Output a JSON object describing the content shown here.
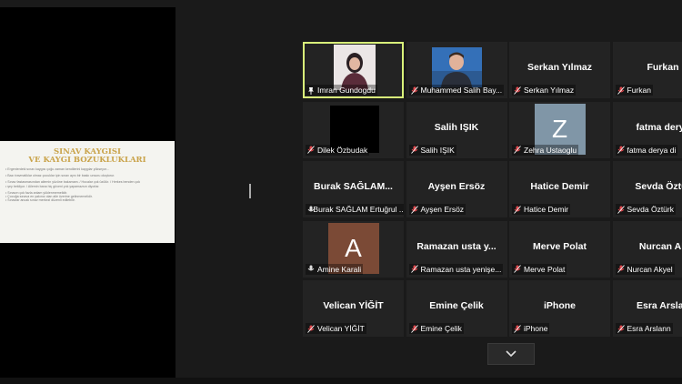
{
  "shared_screen": {
    "title_line1": "SINAV KAYGISI",
    "title_line2": "VE KAYGI BOZUKLUKLARI",
    "lines": [
      "Ergenlerdeki sınav kaygısı çoğu zaman kendilerini kaygılar yükseyor...",
      "",
      "Bazı travmatiklar olmaz çocuklar için sınav aynı bir baskı unsuru oluşturur.",
      "",
      "Sınav fastasmasından ailemin yüzüne bakamam. / Hocalar çok üzülür. / Herkes benden çok",
      "şey bekliyor. / Ailemin bana hiç güveni yok yapamazsın diyorlar.",
      "",
      "Sınavın çok fazla anlam yüklenmemelidir.",
      "Çocuğa sınava en yakınız olan aile üzerine gelinmemelidir.",
      "Sınavlar ancak sınav merkezi düzenli edilebilir."
    ]
  },
  "participants": [
    {
      "display": "",
      "label": "Imran Gundogdu",
      "muted": false,
      "video": "woman",
      "active": true
    },
    {
      "display": "",
      "label": "Muhammed Salih Bay...",
      "muted": true,
      "video": "man"
    },
    {
      "display": "Serkan Yılmaz",
      "label": "Serkan Yılmaz",
      "muted": true
    },
    {
      "display": "Furkan",
      "label": "Furkan",
      "muted": true
    },
    {
      "display": "",
      "label": "Dilek Özbudak",
      "muted": true,
      "video": "black"
    },
    {
      "display": "Salih IŞIK",
      "label": "Salih IŞIK",
      "muted": true
    },
    {
      "display": "",
      "label": "Zehra Ustaoglu",
      "muted": true,
      "avatar": "Z",
      "avatar_color": "#8096a7"
    },
    {
      "display": "fatma derya",
      "label": "fatma derya di",
      "muted": true
    },
    {
      "display": "Burak SAĞLAM...",
      "label": "Burak SAĞLAM Ertuğrul ...",
      "muted": false
    },
    {
      "display": "Ayşen Ersöz",
      "label": "Ayşen Ersöz",
      "muted": true
    },
    {
      "display": "Hatice Demir",
      "label": "Hatice Demir",
      "muted": true
    },
    {
      "display": "Sevda Öztür",
      "label": "Sevda Öztürk",
      "muted": true
    },
    {
      "display": "",
      "label": "Amine Karali",
      "muted": false,
      "avatar": "A",
      "avatar_color": "#7b4a36"
    },
    {
      "display": "Ramazan usta y...",
      "label": "Ramazan usta yenişe...",
      "muted": true
    },
    {
      "display": "Merve  Polat",
      "label": "Merve  Polat",
      "muted": true
    },
    {
      "display": "Nurcan Ak",
      "label": "Nurcan Akyel",
      "muted": true
    },
    {
      "display": "Velican YİĞİT",
      "label": "Velican YİĞİT",
      "muted": true
    },
    {
      "display": "Emine Çelik",
      "label": "Emine Çelik",
      "muted": true
    },
    {
      "display": "iPhone",
      "label": "iPhone",
      "muted": true
    },
    {
      "display": "Esra Arslan",
      "label": "Esra Arslann",
      "muted": true
    }
  ],
  "icons": {
    "scroll": "chevron-down-icon",
    "mic": "mic-muted-icon"
  },
  "colors": {
    "active_border": "#d9f27a",
    "muted_icon": "#e0484d",
    "slide_title": "#c9a34a"
  }
}
